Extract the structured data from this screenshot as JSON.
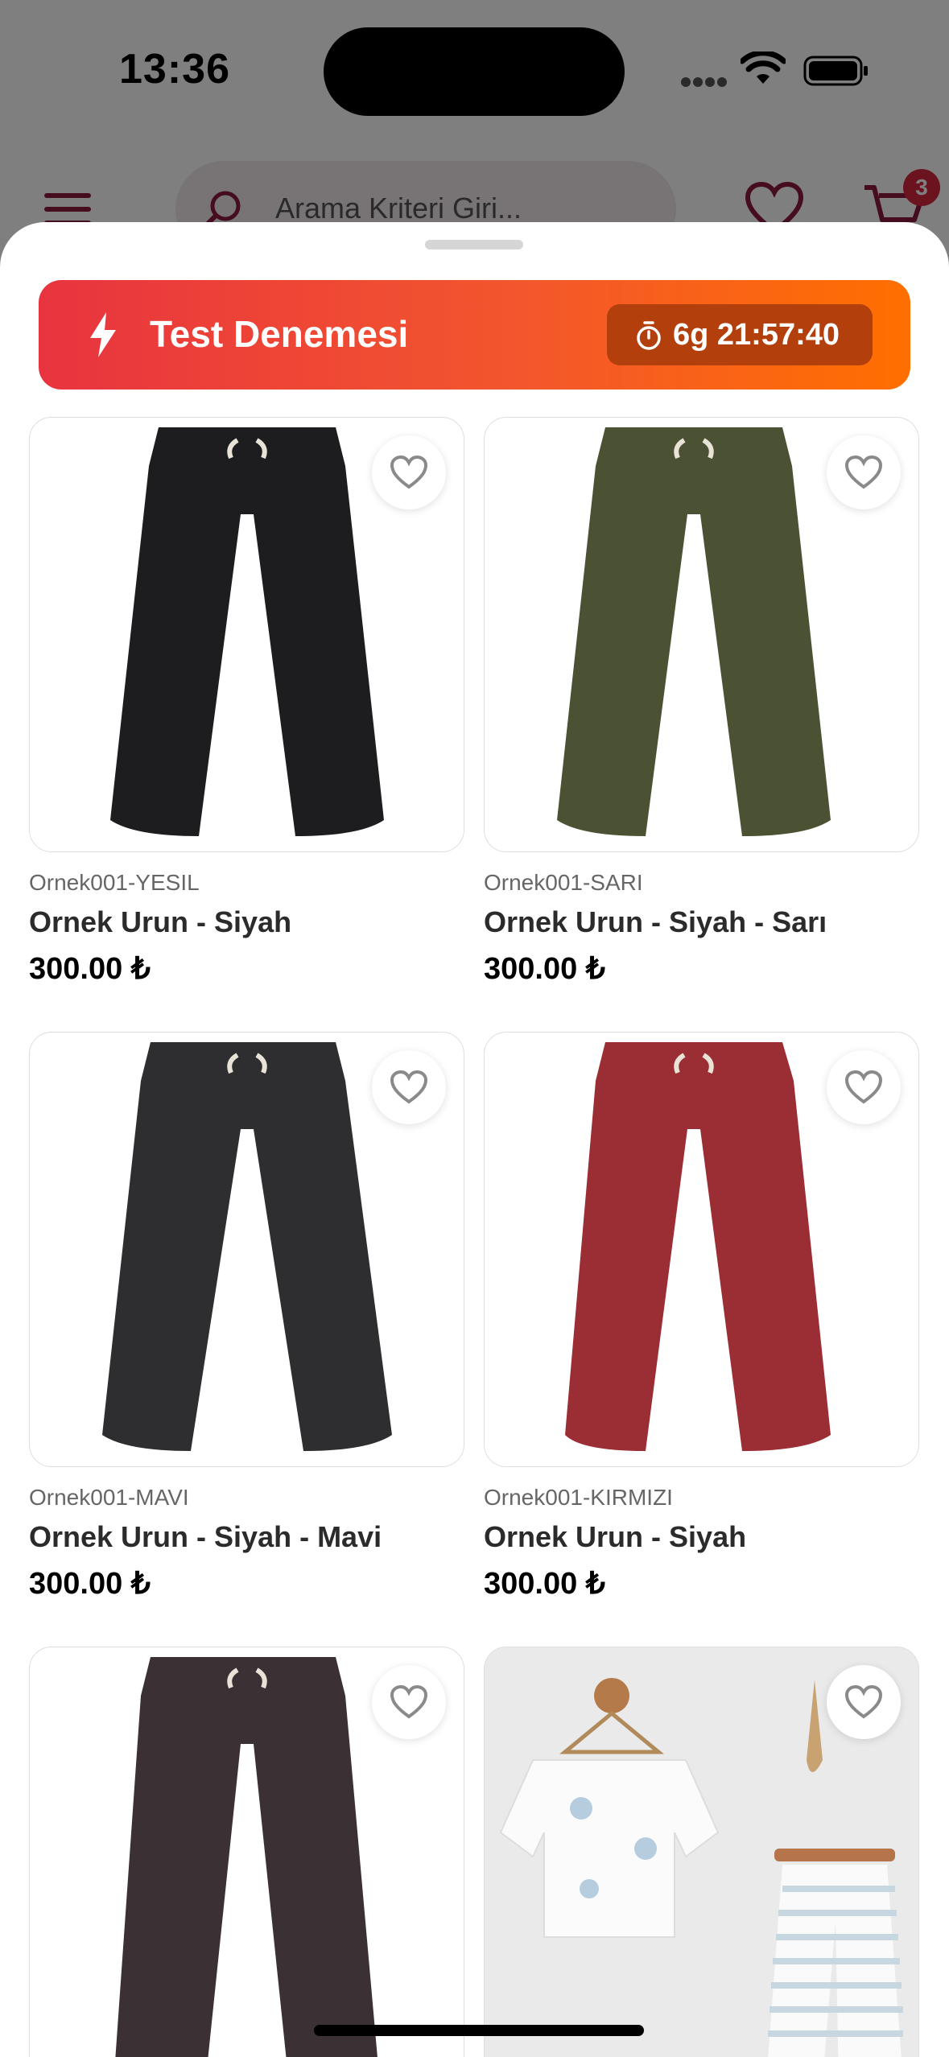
{
  "status_bar": {
    "time": "13:36"
  },
  "header": {
    "search_placeholder": "Arama Kriteri Giri...",
    "cart_count": "3"
  },
  "campaign": {
    "title": "Test Denemesi",
    "countdown": "6g 21:57:40"
  },
  "products": [
    {
      "code": "Ornek001-YESIL",
      "name": "Ornek Urun - Siyah",
      "price": "300.00 ₺",
      "color": "#1d1d1f"
    },
    {
      "code": "Ornek001-SARI",
      "name": "Ornek Urun - Siyah - Sarı",
      "price": "300.00 ₺",
      "color": "#4a5233"
    },
    {
      "code": "Ornek001-MAVI",
      "name": "Ornek Urun - Siyah - Mavi",
      "price": "300.00 ₺",
      "color": "#2e2e30"
    },
    {
      "code": "Ornek001-KIRMIZI",
      "name": "Ornek Urun - Siyah",
      "price": "300.00 ₺",
      "color": "#9b2e34"
    },
    {
      "code": "",
      "name": "",
      "price": "",
      "color": "#3b3134"
    },
    {
      "code": "",
      "name": "",
      "price": "",
      "color": ""
    }
  ],
  "carousel": {
    "color_count": "2"
  },
  "colors": {
    "brand": "#8b1a3a",
    "badge": "#d7263d",
    "banner_start": "#e8343f",
    "banner_end": "#ff6f00"
  }
}
